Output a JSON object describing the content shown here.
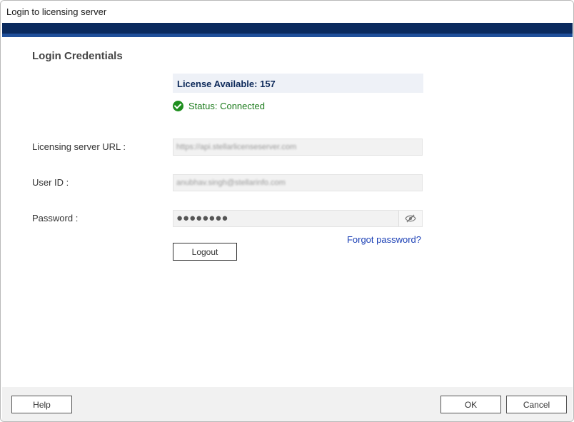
{
  "window": {
    "title": "Login to licensing server"
  },
  "section": {
    "title": "Login Credentials"
  },
  "license": {
    "available_text": "License Available: 157"
  },
  "status": {
    "text": "Status: Connected"
  },
  "fields": {
    "server_url": {
      "label": "Licensing server URL :",
      "value": "https://api.stellarlicenseserver.com"
    },
    "user_id": {
      "label": "User ID :",
      "value": "anubhav.singh@stellarinfo.com"
    },
    "password": {
      "label": "Password :",
      "value": "●●●●●●●●"
    }
  },
  "links": {
    "forgot_password": "Forgot password?"
  },
  "buttons": {
    "logout": "Logout",
    "help": "Help",
    "ok": "OK",
    "cancel": "Cancel"
  },
  "icons": {
    "status": "check-circle-icon",
    "password_toggle": "eye-slash-icon"
  },
  "colors": {
    "header": "#0a2a5e",
    "status_ok": "#1a7a1a",
    "link": "#1a3fb5"
  }
}
